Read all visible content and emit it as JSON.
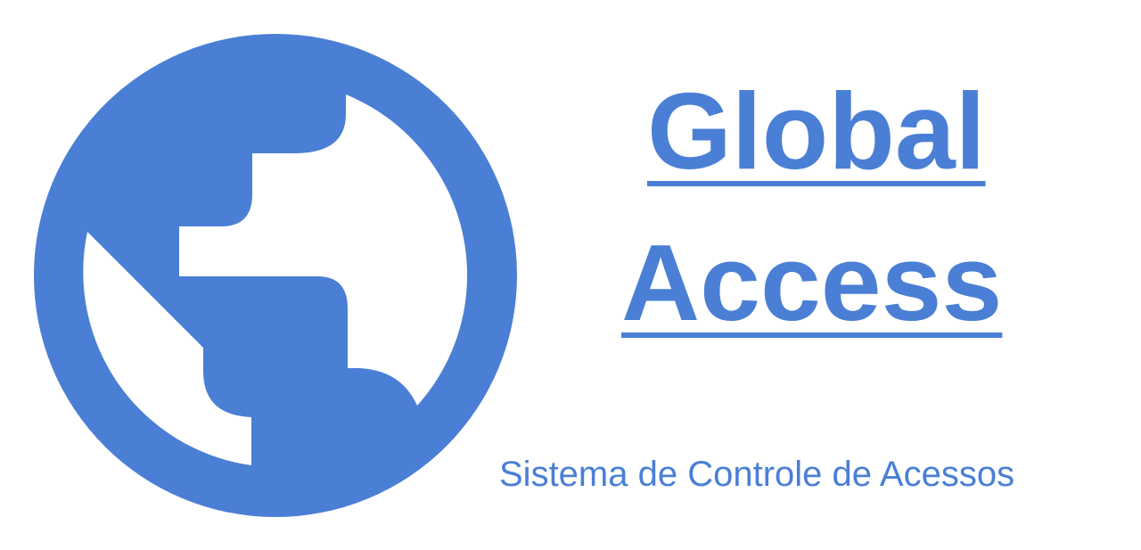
{
  "logo": {
    "icon": "globe-icon",
    "color": "#4a7fd5",
    "title_line1": "Global",
    "title_line2": "Access",
    "subtitle": "Sistema de Controle de Acessos"
  }
}
